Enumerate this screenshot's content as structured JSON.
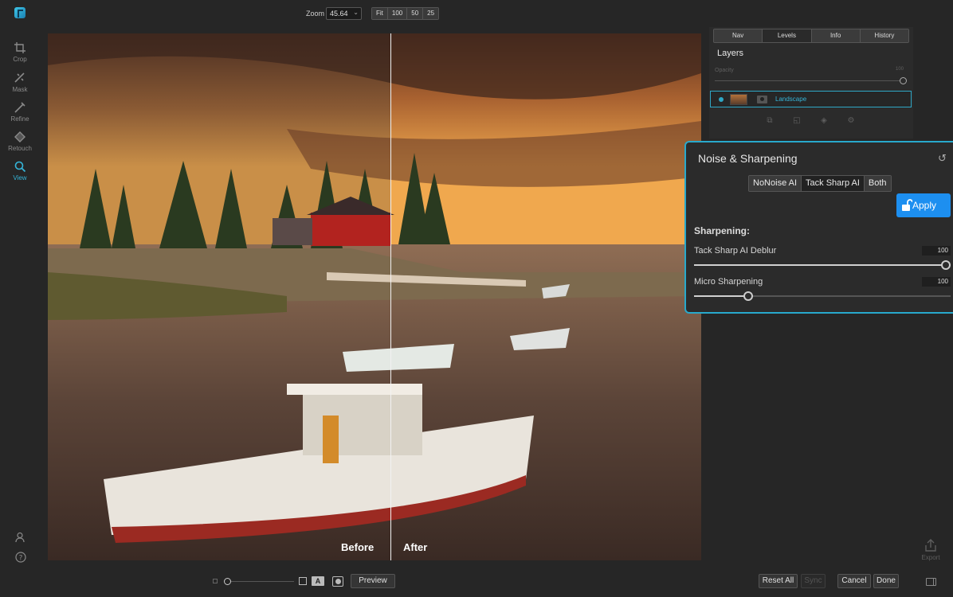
{
  "toolbar": {
    "zoom_label": "Zoom",
    "zoom_value": "45.64",
    "zoom_presets": [
      "Fit",
      "100",
      "50",
      "25"
    ]
  },
  "tools": [
    {
      "label": "Crop",
      "icon": "crop-icon"
    },
    {
      "label": "Mask",
      "icon": "mask-icon"
    },
    {
      "label": "Refine",
      "icon": "refine-icon"
    },
    {
      "label": "Retouch",
      "icon": "retouch-icon"
    },
    {
      "label": "View",
      "icon": "view-icon",
      "active": true
    }
  ],
  "canvas": {
    "before_label": "Before",
    "after_label": "After"
  },
  "right_panel": {
    "tabs": [
      "Nav",
      "Levels",
      "Info",
      "History"
    ],
    "active_tab": "Levels",
    "layers_title": "Layers",
    "opacity_label": "Opacity",
    "opacity_value": "100",
    "layer_name": "Landscape"
  },
  "noise_sharpening": {
    "title": "Noise & Sharpening",
    "modes": [
      "NoNoise AI",
      "Tack Sharp AI",
      "Both"
    ],
    "active_mode": "Tack Sharp AI",
    "apply_label": "Apply",
    "section_label": "Sharpening:",
    "sliders": [
      {
        "label": "Tack Sharp AI Deblur",
        "value": "100",
        "level": 1.0
      },
      {
        "label": "Micro Sharpening",
        "value": "100",
        "level": 0.21
      }
    ]
  },
  "side": {
    "export_label": "Export"
  },
  "bottom": {
    "preview_label": "Preview",
    "reset_all_label": "Reset All",
    "sync_label": "Sync",
    "cancel_label": "Cancel",
    "done_label": "Done"
  },
  "colors": {
    "accent": "#28a9cc",
    "apply": "#1d8ff0"
  }
}
